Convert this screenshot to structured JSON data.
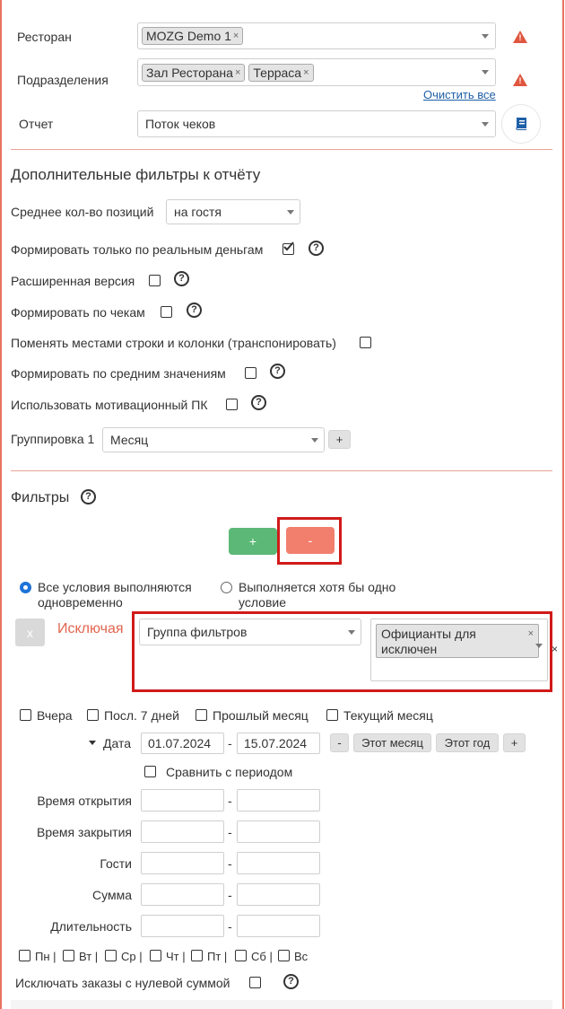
{
  "top": {
    "restaurant_label": "Ресторан",
    "restaurant_tag": "MOZG Demo 1",
    "divisions_label": "Подразделения",
    "division_tags": [
      "Зал Ресторана",
      "Терраса"
    ],
    "clear_all": "Очистить все",
    "report_label": "Отчет",
    "report_value": "Поток чеков",
    "tag_remove": "×",
    "warn_mark": "!"
  },
  "extra": {
    "title": "Дополнительные фильтры к отчёту",
    "avg_positions_label": "Среднее кол-во позиций",
    "avg_positions_value": "на гостя",
    "real_money_label": "Формировать только по реальным деньгам",
    "extended_label": "Расширенная версия",
    "by_checks_label": "Формировать по чекам",
    "transpose_label": "Поменять местами строки и колонки (транспонировать)",
    "by_avg_label": "Формировать по средним значениям",
    "motivation_label": "Использовать мотивационный ПК",
    "grouping_label": "Группировка 1",
    "grouping_value": "Месяц",
    "grouping_add": "+",
    "help": "?"
  },
  "filters": {
    "title": "Фильтры",
    "add": "+",
    "remove": "-",
    "radio_all": [
      "Все условия выполняются",
      "одновременно"
    ],
    "radio_any": [
      "Выполняется хотя бы одно",
      "условие"
    ],
    "x_button": "x",
    "exclude_label": "Исключая",
    "group_value": "Группа фильтров",
    "group_tag": [
      "Официанты для",
      "исключен"
    ],
    "group_tag_remove": "×",
    "outer_remove": "×"
  },
  "periods": {
    "yesterday": "Вчера",
    "last7": "Посл. 7 дней",
    "last_month": "Прошлый месяц",
    "current_month": "Текущий месяц",
    "date_label": "Дата",
    "date_from": "01.07.2024",
    "date_to": "15.07.2024",
    "dash": "-",
    "minus": "-",
    "this_month": "Этот месяц",
    "this_year": "Этот год",
    "plus": "+",
    "compare": "Сравнить с периодом"
  },
  "ranges": [
    {
      "label": "Время открытия"
    },
    {
      "label": "Время закрытия"
    },
    {
      "label": "Гости"
    },
    {
      "label": "Сумма"
    },
    {
      "label": "Длительность"
    }
  ],
  "weekdays": [
    "Пн |",
    "Вт |",
    "Ср |",
    "Чт |",
    "Пт |",
    "Сб |",
    "Вс"
  ],
  "zero_sum_label": "Исключать заказы с нулевой суммой",
  "colors": {
    "accent": "#e8745f",
    "green": "#5cb876",
    "salmon": "#f27f6e",
    "highlight": "#d11a1a",
    "warn": "#e0563f",
    "link": "#1e5fa8"
  }
}
